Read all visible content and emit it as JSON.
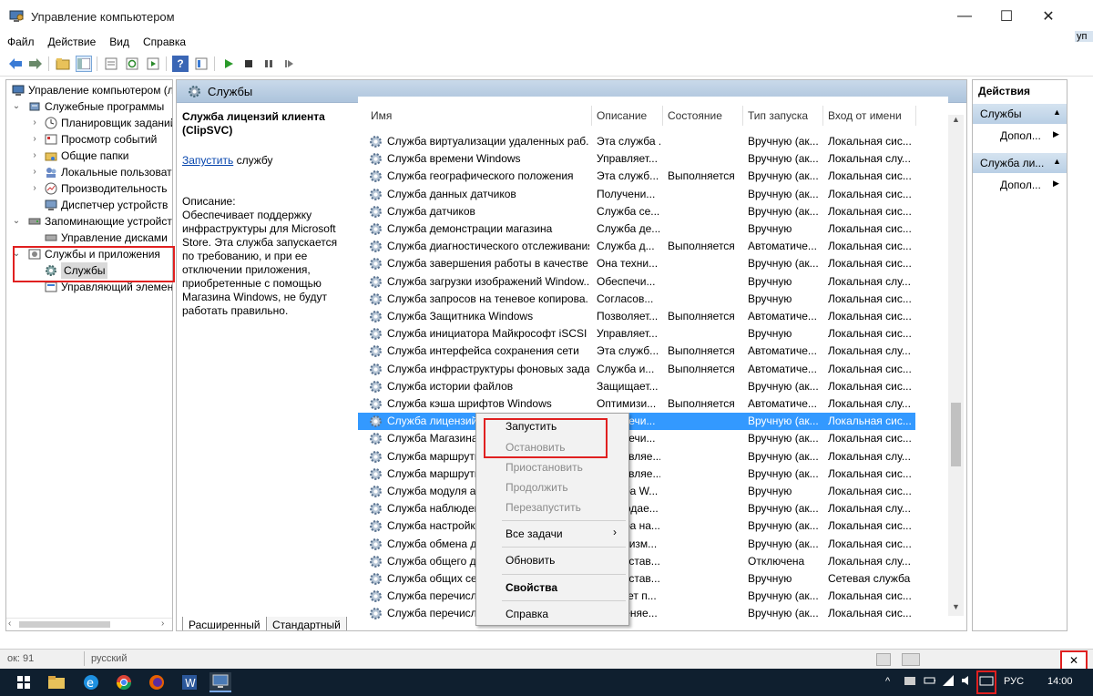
{
  "window": {
    "title": "Управление компьютером",
    "controls": {
      "minimize": "—",
      "maximize": "☐",
      "close": "✕"
    },
    "edge_fragment": "уп"
  },
  "menu": [
    "Файл",
    "Действие",
    "Вид",
    "Справка"
  ],
  "tree": {
    "root": "Управление компьютером (л",
    "utilities": "Служебные программы",
    "scheduler": "Планировщик заданий",
    "events": "Просмотр событий",
    "shared": "Общие папки",
    "users": "Локальные пользовате",
    "perf": "Производительность",
    "devmgr": "Диспетчер устройств",
    "storage": "Запоминающие устройст",
    "diskmgmt": "Управление дисками",
    "svcapps": "Службы и приложения",
    "services": "Службы",
    "wmi": "Управляющий элемен"
  },
  "center": {
    "header": "Службы",
    "selected_title": "Служба лицензий клиента (ClipSVC)",
    "start_link": "Запустить",
    "start_suffix": " службу",
    "desc_label": "Описание:",
    "desc_text": "Обеспечивает поддержку инфраструктуры для Microsoft Store. Эта служба запускается по требованию, и при ее отключении приложения, приобретенные с помощью Магазина Windows, не будут работать правильно.",
    "columns": {
      "name": "Имя",
      "desc": "Описание",
      "status": "Состояние",
      "startup": "Тип запуска",
      "logon": "Вход от имени"
    },
    "rows": [
      {
        "name": "Служба виртуализации удаленных раб...",
        "desc": "Эта служба ...",
        "status": "",
        "startup": "Вручную (ак...",
        "logon": "Локальная сис..."
      },
      {
        "name": "Служба времени Windows",
        "desc": "Управляет...",
        "status": "",
        "startup": "Вручную (ак...",
        "logon": "Локальная слу..."
      },
      {
        "name": "Служба географического положения",
        "desc": "Эта служб...",
        "status": "Выполняется",
        "startup": "Вручную (ак...",
        "logon": "Локальная сис..."
      },
      {
        "name": "Служба данных датчиков",
        "desc": "Получени...",
        "status": "",
        "startup": "Вручную (ак...",
        "logon": "Локальная сис..."
      },
      {
        "name": "Служба датчиков",
        "desc": "Служба се...",
        "status": "",
        "startup": "Вручную (ак...",
        "logon": "Локальная сис..."
      },
      {
        "name": "Служба демонстрации магазина",
        "desc": "Служба де...",
        "status": "",
        "startup": "Вручную",
        "logon": "Локальная сис..."
      },
      {
        "name": "Служба диагностического отслеживания",
        "desc": "Служба д...",
        "status": "Выполняется",
        "startup": "Автоматиче...",
        "logon": "Локальная сис..."
      },
      {
        "name": "Служба завершения работы в качестве ...",
        "desc": "Она техни...",
        "status": "",
        "startup": "Вручную (ак...",
        "logon": "Локальная сис..."
      },
      {
        "name": "Служба загрузки изображений Window...",
        "desc": "Обеспечи...",
        "status": "",
        "startup": "Вручную",
        "logon": "Локальная слу..."
      },
      {
        "name": "Служба запросов на теневое копирова...",
        "desc": "Согласов...",
        "status": "",
        "startup": "Вручную",
        "logon": "Локальная сис..."
      },
      {
        "name": "Служба Защитника Windows",
        "desc": "Позволяет...",
        "status": "Выполняется",
        "startup": "Автоматиче...",
        "logon": "Локальная сис..."
      },
      {
        "name": "Служба инициатора Майкрософт iSCSI",
        "desc": "Управляет...",
        "status": "",
        "startup": "Вручную",
        "logon": "Локальная сис..."
      },
      {
        "name": "Служба интерфейса сохранения сети",
        "desc": "Эта служб...",
        "status": "Выполняется",
        "startup": "Автоматиче...",
        "logon": "Локальная слу..."
      },
      {
        "name": "Служба инфраструктуры фоновых задач",
        "desc": "Служба и...",
        "status": "Выполняется",
        "startup": "Автоматиче...",
        "logon": "Локальная сис..."
      },
      {
        "name": "Служба истории файлов",
        "desc": "Защищает...",
        "status": "",
        "startup": "Вручную (ак...",
        "logon": "Локальная сис..."
      },
      {
        "name": "Служба кэша шрифтов Windows",
        "desc": "Оптимизи...",
        "status": "Выполняется",
        "startup": "Автоматиче...",
        "logon": "Локальная слу..."
      },
      {
        "name": "Служба лицензий клиента (ClipSVC)",
        "desc": "Обеспечи...",
        "status": "",
        "startup": "Вручную (ак...",
        "logon": "Локальная сис..."
      },
      {
        "name": "Служба Магазина Windows (WSService)",
        "desc": "Обеспечи...",
        "status": "",
        "startup": "Вручную (ак...",
        "logon": "Локальная сис..."
      },
      {
        "name": "Служба маршрутизатора AllJoyn",
        "desc": "Направляе...",
        "status": "",
        "startup": "Вручную (ак...",
        "logon": "Локальная слу..."
      },
      {
        "name": "Служба маршрутизатора SMS Microsoft ...",
        "desc": "Направляе...",
        "status": "",
        "startup": "Вручную (ак...",
        "logon": "Локальная сис..."
      },
      {
        "name": "Служба модуля архивации на уровне ...",
        "desc": "Служба W...",
        "status": "",
        "startup": "Вручную",
        "logon": "Локальная сис..."
      },
      {
        "name": "Служба наблюдения за датчиками",
        "desc": "Наблюдае...",
        "status": "",
        "startup": "Вручную (ак...",
        "logon": "Локальная слу..."
      },
      {
        "name": "Служба настройки сети",
        "desc": "Служба на...",
        "status": "",
        "startup": "Вручную (ак...",
        "logon": "Локальная сис..."
      },
      {
        "name": "Служба обмена данными (Hyper-V)",
        "desc": "Механизм...",
        "status": "",
        "startup": "Вручную (ак...",
        "logon": "Локальная сис..."
      },
      {
        "name": "Служба общего доступа к портам Net.Tcp",
        "desc": "Предостав...",
        "status": "",
        "startup": "Отключена",
        "logon": "Локальная слу..."
      },
      {
        "name": "Служба общих сетевых ресурсов прои...",
        "desc": "Предостав...",
        "status": "",
        "startup": "Вручную",
        "logon": "Сетевая служба"
      },
      {
        "name": "Служба перечисления устройств чтен...",
        "desc": "Создает п...",
        "status": "",
        "startup": "Вручную (ак...",
        "logon": "Локальная сис..."
      },
      {
        "name": "Служба перечислителя переносных ус...",
        "desc": "Применяе...",
        "status": "",
        "startup": "Вручную (ак...",
        "logon": "Локальная сис..."
      }
    ],
    "tabs": [
      "Расширенный",
      "Стандартный"
    ]
  },
  "actions": {
    "header": "Действия",
    "sec1": "Службы",
    "more1": "Допол...",
    "sec2": "Служба ли...",
    "more2": "Допол..."
  },
  "context_menu": {
    "start": "Запустить",
    "stop": "Остановить",
    "pause": "Приостановить",
    "resume": "Продолжить",
    "restart": "Перезапустить",
    "all_tasks": "Все задачи",
    "refresh": "Обновить",
    "properties": "Свойства",
    "help": "Справка"
  },
  "status": {
    "count": "ок: 91",
    "lang": "русский"
  },
  "taskbar": {
    "lang": "РУС",
    "time": "14:00"
  },
  "colors": {
    "selection": "#3399ff",
    "highlight_box": "#e02020",
    "link": "#0645ad"
  }
}
